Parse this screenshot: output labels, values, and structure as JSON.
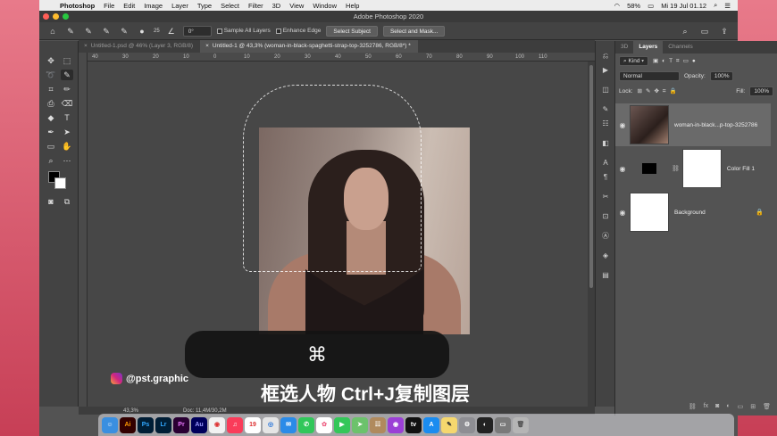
{
  "menubar": {
    "app_name": "Photoshop",
    "items": [
      "File",
      "Edit",
      "Image",
      "Layer",
      "Type",
      "Select",
      "Filter",
      "3D",
      "View",
      "Window",
      "Help"
    ],
    "battery": "58%",
    "datetime": "Mi 19 Jul 01.12"
  },
  "window": {
    "title": "Adobe Photoshop 2020"
  },
  "options": {
    "brush_size": "25",
    "angle": "0°",
    "sample_all_layers": "Sample All Layers",
    "enhance_edge": "Enhance Edge",
    "select_subject": "Select Subject",
    "select_and_mask": "Select and Mask..."
  },
  "tabs": [
    {
      "label": "Untitled-1.psd @ 46% (Layer 3, RGB/8)"
    },
    {
      "label": "Untitled-1 @ 43,3% (woman-in-black-spaghetti-strap-top-3252786, RGB/8*) *"
    }
  ],
  "ruler": {
    "ticks": [
      "40",
      "30",
      "20",
      "10",
      "0",
      "10",
      "20",
      "30",
      "40",
      "50",
      "60",
      "70",
      "80",
      "90",
      "100",
      "110"
    ]
  },
  "overlay": {
    "cmd_symbol": "⌘",
    "watermark": "@pst.graphic",
    "subtitle": "框选人物 Ctrl+J复制图层"
  },
  "status": {
    "zoom": "43,3%",
    "doc": "Doc: 11,4M/30,2M"
  },
  "layers_panel": {
    "tabs": [
      "3D",
      "Layers",
      "Channels"
    ],
    "kind": "Kind",
    "blend_mode": "Normal",
    "opacity_label": "Opacity:",
    "opacity_value": "100%",
    "lock_label": "Lock:",
    "fill_label": "Fill:",
    "fill_value": "100%",
    "layers": [
      {
        "name": "woman-in-black...p-top-3252786"
      },
      {
        "name": "Color Fill 1"
      },
      {
        "name": "Background"
      }
    ]
  },
  "dock": {
    "apps": [
      "Finder",
      "Ai",
      "Ps",
      "Lr",
      "Pr",
      "Au",
      "Chrome",
      "Music",
      "Calendar",
      "Safari",
      "Mail",
      "Messages",
      "Photos",
      "FaceTime",
      "Maps",
      "Contacts",
      "Podcasts",
      "TV",
      "App Store",
      "Notes",
      "Preferences",
      "Photoshop",
      "Finder2",
      "Trash"
    ]
  }
}
